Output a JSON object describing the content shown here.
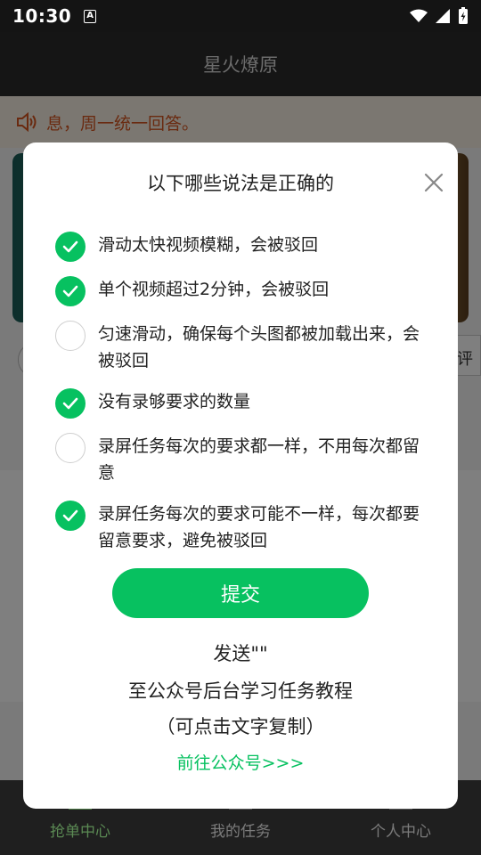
{
  "status_bar": {
    "time": "10:30",
    "notif_letter": "A"
  },
  "header": {
    "title": "星火燎原"
  },
  "background": {
    "marquee_text": "息，周一统一回答。",
    "chip_right_text": "评"
  },
  "dialog": {
    "title": "以下哪些说法是正确的",
    "options": [
      {
        "text": "滑动太快视频模糊，会被驳回",
        "checked": true
      },
      {
        "text": "单个视频超过2分钟，会被驳回",
        "checked": true
      },
      {
        "text": "匀速滑动，确保每个头图都被加载出来，会被驳回",
        "checked": false
      },
      {
        "text": "没有录够要求的数量",
        "checked": true
      },
      {
        "text": "录屏任务每次的要求都一样，不用每次都留意",
        "checked": false
      },
      {
        "text": "录屏任务每次的要求可能不一样，每次都要留意要求，避免被驳回",
        "checked": true
      }
    ],
    "submit_label": "提交",
    "info_line1": "发送\"\"",
    "info_line2": "至公众号后台学习任务教程",
    "info_line3": "（可点击文字复制）",
    "link_label": "前往公众号>>>"
  },
  "bottom_nav": {
    "items": [
      {
        "label": "抢单中心",
        "active": true
      },
      {
        "label": "我的任务",
        "active": false
      },
      {
        "label": "个人中心",
        "active": false
      }
    ]
  },
  "colors": {
    "accent": "#07c160",
    "marquee": "#d45520"
  }
}
